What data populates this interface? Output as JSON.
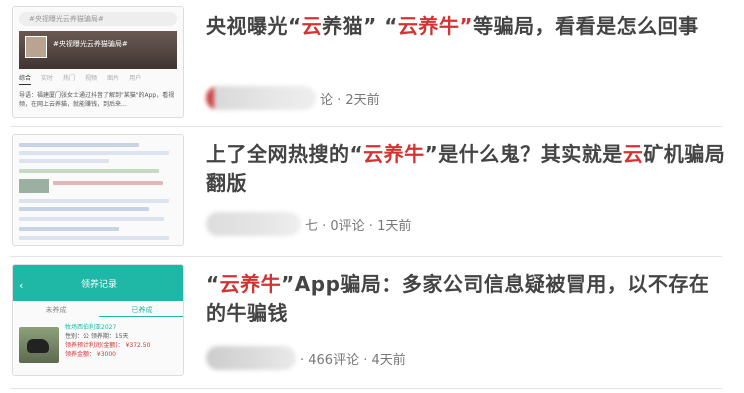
{
  "items": [
    {
      "title_parts": [
        {
          "text": "央视曝光",
          "style": "q"
        },
        {
          "text": "“",
          "style": "q"
        },
        {
          "text": "云",
          "style": "red"
        },
        {
          "text": "养猫”",
          "style": "q"
        },
        {
          "text": " “",
          "style": "q"
        },
        {
          "text": "云",
          "style": "red"
        },
        {
          "text": "养牛”",
          "style": "red"
        },
        {
          "text": "等骗局，看看是怎么回事",
          "style": "q"
        }
      ],
      "meta": "论 · 2天前",
      "thumb": {
        "search": "#央视曝光云养猫骗局#",
        "banner_title": "#央视曝光云养猫骗局#",
        "tabs": [
          "综合",
          "实时",
          "热门",
          "视频",
          "图片",
          "用户"
        ],
        "text": "导语：福建厦门张女士通过抖音了解到\"某猫\"的App，看视频，在网上云养猫，就能赚钱，到后来..."
      }
    },
    {
      "title_parts": [
        {
          "text": "上了全网热搜的“",
          "style": "q"
        },
        {
          "text": "云养牛",
          "style": "red"
        },
        {
          "text": "”是什么鬼？其实就是",
          "style": "q"
        },
        {
          "text": "云",
          "style": "red"
        },
        {
          "text": "矿机骗局翻版",
          "style": "q"
        }
      ],
      "meta": "七 · 0评论 · 1天前"
    },
    {
      "title_parts": [
        {
          "text": "“",
          "style": "q"
        },
        {
          "text": "云养牛",
          "style": "red"
        },
        {
          "text": "”App骗局：多家公司信息疑被冒用，以不存在的牛骗钱",
          "style": "q"
        }
      ],
      "meta": "· 466评论 · 4天前",
      "thumb": {
        "app_title": "领养记录",
        "tabs": [
          "未养成",
          "已养成"
        ],
        "cow_name": "牧场西伯利亚2027",
        "fields": [
          "性别：公    领养期：15天",
          "领养预计利润(金额)： ¥372.50",
          "领养金额：  ¥3000"
        ]
      }
    }
  ]
}
